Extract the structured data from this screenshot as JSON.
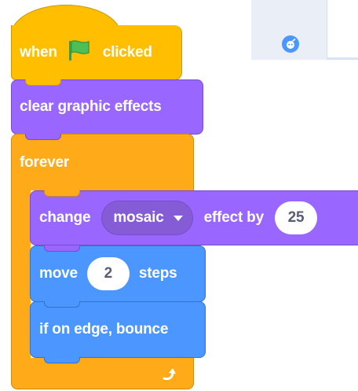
{
  "colors": {
    "events": "#ffbf00",
    "looks": "#9966ff",
    "motion": "#4c97ff",
    "control": "#ffab19",
    "green_flag": "#4cbf56",
    "input_text": "#575e75"
  },
  "sprite_panel": {
    "icon": "sprite-face-icon"
  },
  "script": {
    "hat": {
      "text_before": "when",
      "flag_icon": "green-flag-icon",
      "text_after": "clicked"
    },
    "clear_effects": {
      "label": "clear graphic effects"
    },
    "forever": {
      "label": "forever",
      "loop_icon": "loop-arrow-icon"
    },
    "change_effect": {
      "label_before": "change",
      "dropdown_value": "mosaic",
      "label_after": "effect by",
      "value": "25"
    },
    "move": {
      "label_before": "move",
      "value": "2",
      "label_after": "steps"
    },
    "bounce": {
      "label": "if on edge, bounce"
    }
  }
}
